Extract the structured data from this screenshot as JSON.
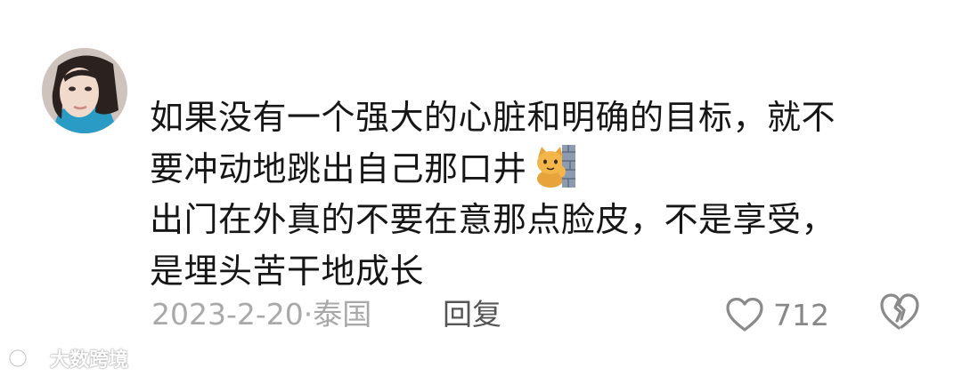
{
  "comment": {
    "lines": [
      "如果没有一个强大的心脏和明确的目标，就不",
      "要冲动地跳出自己那口井",
      "出门在外真的不要在意那点脸皮，不是享受，",
      "是埋头苦干地成长"
    ],
    "emoji": "cat-peeking-from-wall-emoji"
  },
  "meta": {
    "date": "2023-2-20",
    "separator": "·",
    "location": "泰国",
    "reply_label": "回复"
  },
  "actions": {
    "like_count": "712"
  },
  "watermark": {
    "text": "大数跨境"
  },
  "colors": {
    "text": "#161616",
    "meta": "#a9a9a9",
    "icon": "#888888"
  }
}
